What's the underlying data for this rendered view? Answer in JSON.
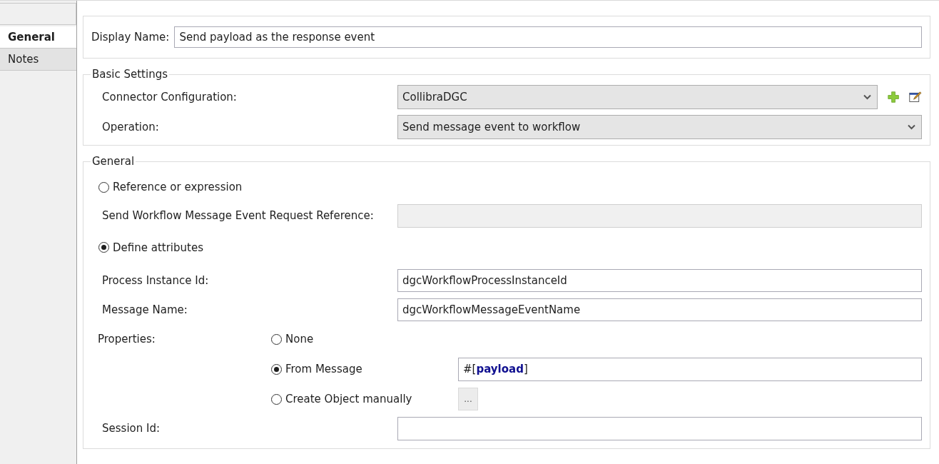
{
  "tabs": [
    {
      "label": "General",
      "selected": true
    },
    {
      "label": "Notes",
      "selected": false
    }
  ],
  "display_name": {
    "label": "Display Name:",
    "value": "Send payload as the response event"
  },
  "basic_settings": {
    "title": "Basic Settings",
    "rows": [
      {
        "label": "Connector Configuration:",
        "value": "CollibraDGC",
        "actions": true
      },
      {
        "label": "Operation:",
        "value": "Send message event to workflow",
        "actions": false
      }
    ]
  },
  "general": {
    "title": "General",
    "reference_option": {
      "label": "Reference or expression",
      "selected": false
    },
    "reference_field": {
      "label": "Send Workflow Message Event Request Reference:",
      "disabled": true
    },
    "attributes_option": {
      "label": "Define attributes",
      "selected": true
    },
    "attributes": [
      {
        "label": "Process Instance Id:",
        "value": "dgcWorkflowProcessInstanceId"
      },
      {
        "label": "Message Name:",
        "value": "dgcWorkflowMessageEventName"
      }
    ],
    "properties": {
      "label": "Properties:",
      "options": [
        {
          "kind": "plain",
          "label": "None",
          "selected": false
        },
        {
          "kind": "expression",
          "label": "From Message",
          "selected": true,
          "value": "#[**payload**]"
        },
        {
          "kind": "button",
          "label": "Create Object manually",
          "selected": false,
          "button": "..."
        }
      ]
    },
    "session": {
      "label": "Session Id:"
    }
  }
}
